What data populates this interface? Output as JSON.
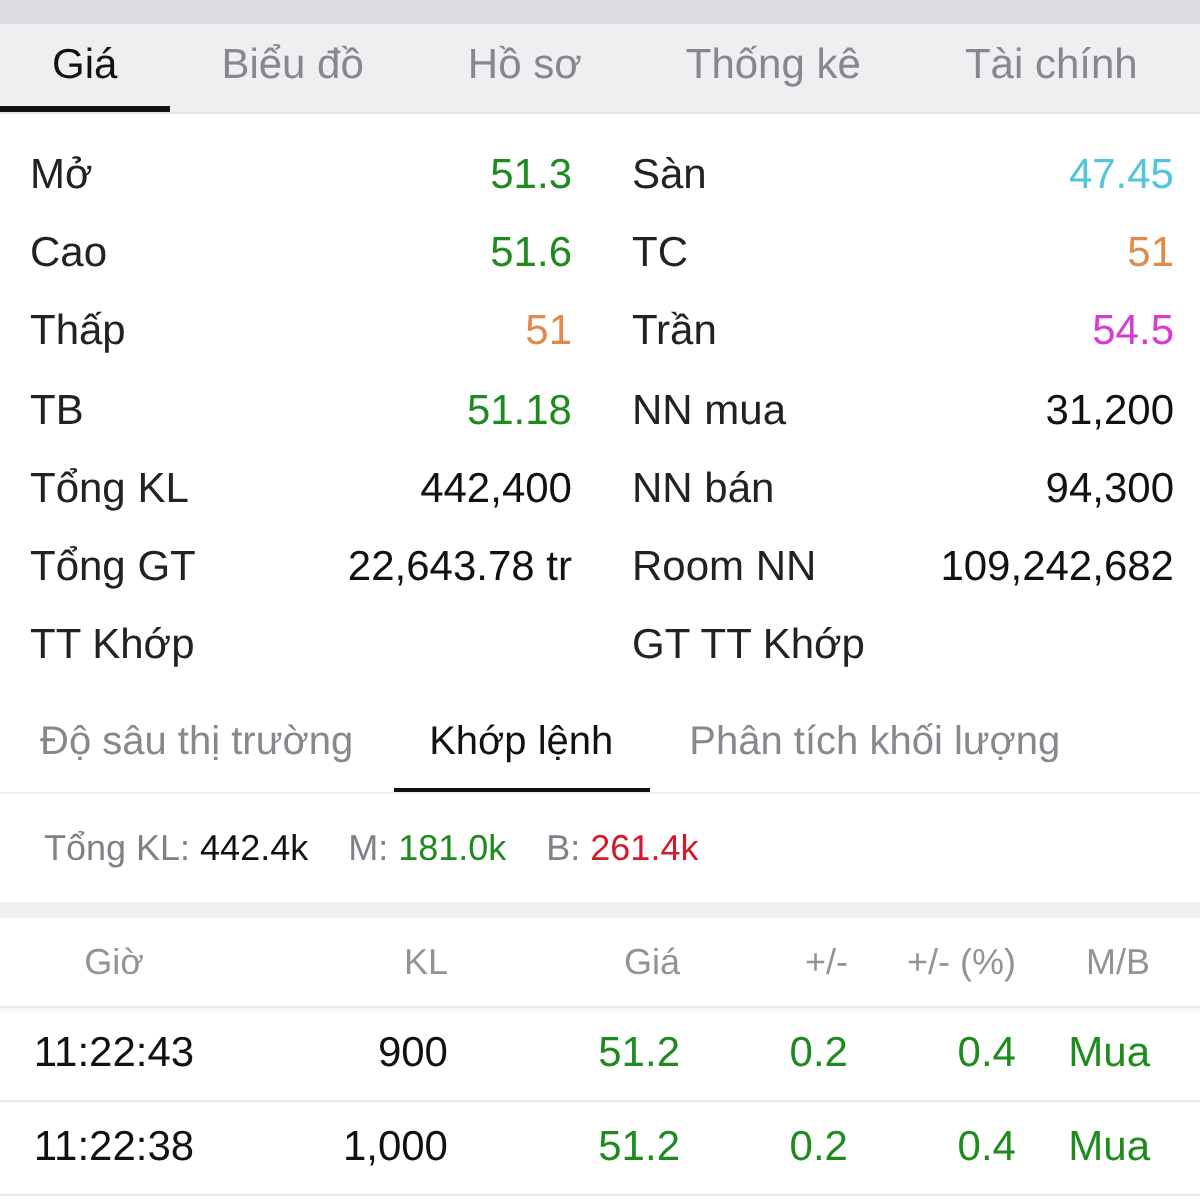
{
  "tabs": [
    {
      "label": "Giá",
      "selected": true
    },
    {
      "label": "Biểu đồ",
      "selected": false
    },
    {
      "label": "Hồ sơ",
      "selected": false
    },
    {
      "label": "Thống kê",
      "selected": false
    },
    {
      "label": "Tài chính",
      "selected": false
    }
  ],
  "stats": [
    {
      "left": {
        "label": "Mở",
        "value": "51.3",
        "color": "#1e8b1e"
      },
      "right": {
        "label": "Sàn",
        "value": "47.45",
        "color": "#52c5dc"
      }
    },
    {
      "left": {
        "label": "Cao",
        "value": "51.6",
        "color": "#1e8b1e"
      },
      "right": {
        "label": "TC",
        "value": "51",
        "color": "#e08a4c"
      }
    },
    {
      "left": {
        "label": "Thấp",
        "value": "51",
        "color": "#e08a4c"
      },
      "right": {
        "label": "Trần",
        "value": "54.5",
        "color": "#d63bd6"
      }
    },
    {
      "left": {
        "label": "TB",
        "value": "51.18",
        "color": "#1e8b1e"
      },
      "right": {
        "label": "NN mua",
        "value": "31,200",
        "color": "#111111"
      }
    },
    {
      "left": {
        "label": "Tổng KL",
        "value": "442,400",
        "color": "#111111"
      },
      "right": {
        "label": "NN bán",
        "value": "94,300",
        "color": "#111111"
      }
    },
    {
      "left": {
        "label": "Tổng GT",
        "value": "22,643.78 tr",
        "color": "#111111"
      },
      "right": {
        "label": "Room NN",
        "value": "109,242,682",
        "color": "#111111"
      }
    },
    {
      "left": {
        "label": "TT Khớp"
      },
      "right": {
        "label": "GT TT Khớp"
      }
    }
  ],
  "sub_tabs": [
    {
      "label": "Độ sâu thị trường",
      "selected": false
    },
    {
      "label": "Khớp lệnh",
      "selected": true
    },
    {
      "label": "Phân tích khối lượng",
      "selected": false
    }
  ],
  "summary": [
    {
      "label": "Tổng KL:",
      "value": "442.4k",
      "color": "#111111"
    },
    {
      "label": "M:",
      "value": "181.0k",
      "color": "#1e8b1e"
    },
    {
      "label": "B:",
      "value": "261.4k",
      "color": "#d3192b"
    }
  ],
  "trades": {
    "columns": [
      "Giờ",
      "KL",
      "Giá",
      "+/-",
      "+/- (%)",
      "M/B"
    ],
    "rows": [
      {
        "time": "11:22:43",
        "volume": "900",
        "price": "51.2",
        "change": "0.2",
        "change_pct": "0.4",
        "side": "Mua",
        "color": "#1e8b1e"
      },
      {
        "time": "11:22:38",
        "volume": "1,000",
        "price": "51.2",
        "change": "0.2",
        "change_pct": "0.4",
        "side": "Mua",
        "color": "#1e8b1e"
      }
    ]
  }
}
